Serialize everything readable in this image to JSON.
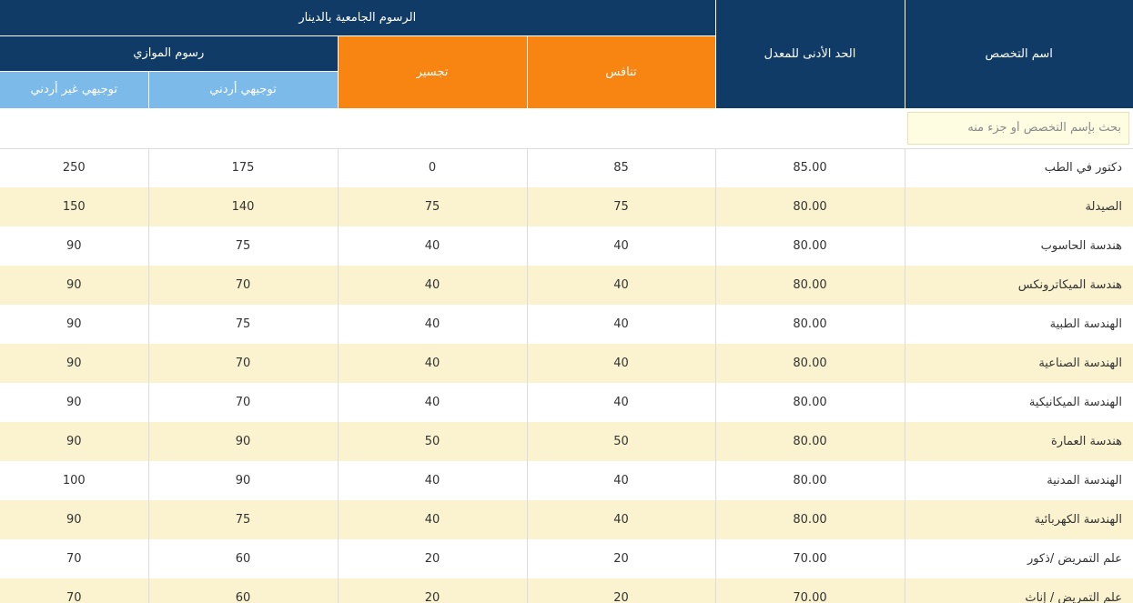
{
  "header": {
    "fees_group": "الرسوم الجامعية بالدينار",
    "parallel_group": "رسوم الموازي",
    "col_non_jordanian": "توجيهي غير أردني",
    "col_jordanian": "توجيهي أردني",
    "col_bridging": "تجسير",
    "col_competition": "تنافس",
    "col_min_avg": "الحد الأدنى للمعدل",
    "col_major": "اسم التخصص"
  },
  "colors": {
    "navy": "#0f3b66",
    "orange": "#f88412",
    "light_blue": "#7cbbe9",
    "stripe": "#fbf3cf"
  },
  "search": {
    "placeholder": "بحث بإسم التخصص أو جزء منه",
    "value": ""
  },
  "rows": [
    {
      "major": "دكتور في الطب",
      "min_avg": "85.00",
      "competition": "85",
      "bridging": "0",
      "jordanian": "175",
      "non_jordanian": "250"
    },
    {
      "major": "الصيدلة",
      "min_avg": "80.00",
      "competition": "75",
      "bridging": "75",
      "jordanian": "140",
      "non_jordanian": "150"
    },
    {
      "major": "هندسة الحاسوب",
      "min_avg": "80.00",
      "competition": "40",
      "bridging": "40",
      "jordanian": "75",
      "non_jordanian": "90"
    },
    {
      "major": "هندسة الميكاترونكس",
      "min_avg": "80.00",
      "competition": "40",
      "bridging": "40",
      "jordanian": "70",
      "non_jordanian": "90"
    },
    {
      "major": "الهندسة الطبية",
      "min_avg": "80.00",
      "competition": "40",
      "bridging": "40",
      "jordanian": "75",
      "non_jordanian": "90"
    },
    {
      "major": "الهندسة الصناعية",
      "min_avg": "80.00",
      "competition": "40",
      "bridging": "40",
      "jordanian": "70",
      "non_jordanian": "90"
    },
    {
      "major": "الهندسة الميكانيكية",
      "min_avg": "80.00",
      "competition": "40",
      "bridging": "40",
      "jordanian": "70",
      "non_jordanian": "90"
    },
    {
      "major": "هندسة العمارة",
      "min_avg": "80.00",
      "competition": "50",
      "bridging": "50",
      "jordanian": "90",
      "non_jordanian": "90"
    },
    {
      "major": "الهندسة المدنية",
      "min_avg": "80.00",
      "competition": "40",
      "bridging": "40",
      "jordanian": "90",
      "non_jordanian": "100"
    },
    {
      "major": "الهندسة الكهربائية",
      "min_avg": "80.00",
      "competition": "40",
      "bridging": "40",
      "jordanian": "75",
      "non_jordanian": "90"
    },
    {
      "major": "علم التمريض /ذكور",
      "min_avg": "70.00",
      "competition": "20",
      "bridging": "20",
      "jordanian": "60",
      "non_jordanian": "70"
    },
    {
      "major": "علم التمريض / إناث",
      "min_avg": "70.00",
      "competition": "20",
      "bridging": "20",
      "jordanian": "60",
      "non_jordanian": "70"
    }
  ]
}
